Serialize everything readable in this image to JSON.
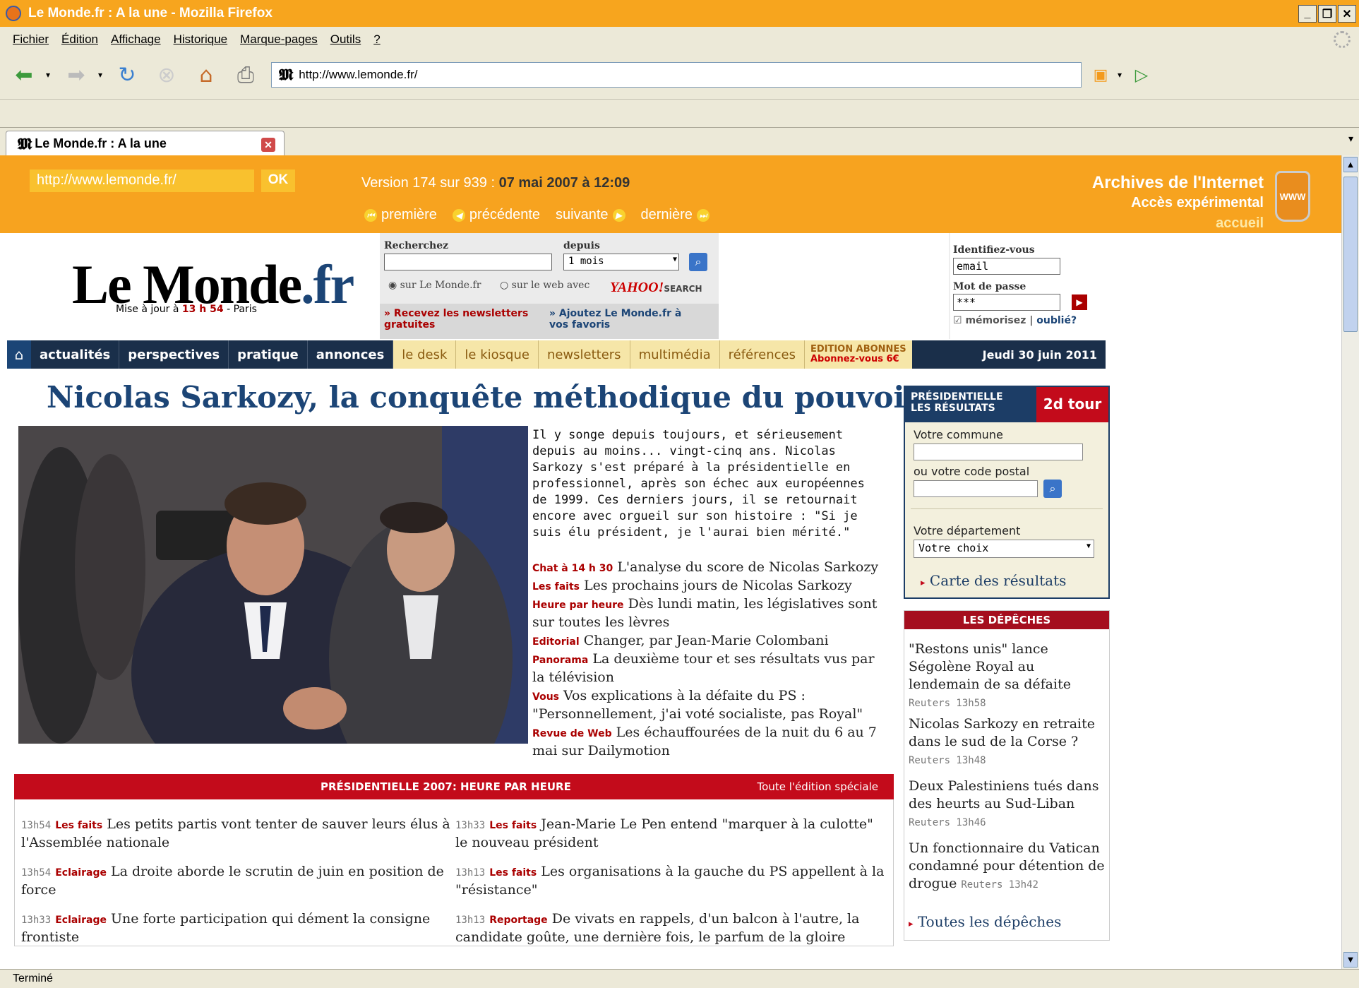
{
  "browser": {
    "window_title": "Le Monde.fr : A la une - Mozilla Firefox",
    "menu": [
      "Fichier",
      "Édition",
      "Affichage",
      "Historique",
      "Marque-pages",
      "Outils",
      "?"
    ],
    "url": "http://www.lemonde.fr/",
    "tab_title": "Le Monde.fr : A la une",
    "status": "Terminé"
  },
  "wayback": {
    "url_input": "http://www.lemonde.fr/",
    "ok": "OK",
    "version_prefix": "Version 174 sur 939 :",
    "version_date": "07 mai 2007 à 12:09",
    "nav": [
      "première",
      "précédente",
      "suivante",
      "dernière"
    ],
    "title": "Archives de l'Internet",
    "subtitle": "Accès expérimental",
    "home": "accueil",
    "can_label": "WWW"
  },
  "site": {
    "logo_main": "Le Monde",
    "logo_tld": ".fr",
    "updated_prefix": "Mise à jour à",
    "updated_time": "13 h 54",
    "updated_suffix": "- Paris",
    "search_label": "Recherchez",
    "since_label": "depuis",
    "since_value": "1 mois",
    "radio_site": "sur Le Monde.fr",
    "radio_web": "sur le web avec",
    "yahoo": "YAHOO!",
    "yahoo_search": "SEARCH",
    "newsletters_link": "» Recevez les newsletters gratuites",
    "favoris_link": "» Ajoutez Le Monde.fr à vos favoris",
    "login_label": "Identifiez-vous",
    "email_value": "email",
    "password_label": "Mot de passe",
    "password_value": "***",
    "remember": "mémorisez",
    "forgot": "oublié?"
  },
  "nav": {
    "main": [
      "actualités",
      "perspectives",
      "pratique",
      "annonces"
    ],
    "secondary": [
      "le desk",
      "le kiosque",
      "newsletters",
      "multimédia",
      "références"
    ],
    "abonnes_1": "EDITION ABONNES",
    "abonnes_2": "Abonnez-vous 6€",
    "date": "Jeudi 30 juin 2011"
  },
  "article": {
    "headline": "Nicolas Sarkozy, la conquête méthodique du pouvoir",
    "lede": "Il y songe depuis toujours, et sérieusement depuis au moins... vingt-cinq ans. Nicolas Sarkozy s'est préparé à la présidentielle en professionnel, après son échec aux européennes de 1999. Ces derniers jours, il se retournait encore avec orgueil sur son histoire : \"Si je suis élu président, je l'aurai bien mérité.\"",
    "links": [
      {
        "tag": "Chat à 14 h 30",
        "text": "L'analyse du score de Nicolas Sarkozy"
      },
      {
        "tag": "Les faits",
        "text": "Les prochains jours de Nicolas Sarkozy"
      },
      {
        "tag": "Heure par heure",
        "text": "Dès lundi matin, les législatives sont sur toutes les lèvres"
      },
      {
        "tag": "Editorial",
        "text": "Changer, par Jean-Marie Colombani"
      },
      {
        "tag": "Panorama",
        "text": "La deuxième tour et ses résultats vus par la télévision"
      },
      {
        "tag": "Vous",
        "text": "Vos explications à la défaite du PS : \"Personnellement, j'ai voté socialiste, pas Royal\""
      },
      {
        "tag": "Revue de Web",
        "text": "Les échauffourées de la nuit du 6 au 7 mai sur Dailymotion"
      }
    ]
  },
  "hourly": {
    "title": "PRÉSIDENTIELLE 2007: HEURE PAR HEURE",
    "link": "Toute l'édition spéciale",
    "left": [
      {
        "time": "13h54",
        "tag": "Les faits",
        "text": "Les petits partis vont tenter de sauver leurs élus à l'Assemblée nationale"
      },
      {
        "time": "13h54",
        "tag": "Eclairage",
        "text": "La droite aborde le scrutin de juin en position de force"
      },
      {
        "time": "13h33",
        "tag": "Eclairage",
        "text": "Une forte participation qui dément la consigne frontiste"
      }
    ],
    "right": [
      {
        "time": "13h33",
        "tag": "Les faits",
        "text": "Jean-Marie Le Pen entend \"marquer à la culotte\" le nouveau président"
      },
      {
        "time": "13h13",
        "tag": "Les faits",
        "text": "Les organisations à la gauche du PS appellent à la \"résistance\""
      },
      {
        "time": "13h13",
        "tag": "Reportage",
        "text": "De vivats en rappels, d'un balcon à l'autre, la candidate goûte, une dernière fois, le parfum de la gloire"
      }
    ]
  },
  "results": {
    "title_1": "PRÉSIDENTIELLE",
    "title_2": "LES RÉSULTATS",
    "round": "2d tour",
    "commune_label": "Votre commune",
    "postal_label": "ou votre code postal",
    "dept_label": "Votre département",
    "dept_value": "Votre choix",
    "map_link": "Carte des résultats"
  },
  "depeches": {
    "title": "LES DÉPÊCHES",
    "items": [
      {
        "text": "\"Restons unis\" lance Ségolène Royal au lendemain de sa défaite",
        "src": "Reuters 13h58"
      },
      {
        "text": "Nicolas Sarkozy en retraite dans le sud de la Corse ?",
        "src": "Reuters 13h48"
      },
      {
        "text": "Deux Palestiniens tués dans des heurts au Sud-Liban",
        "src": "Reuters 13h46"
      },
      {
        "text": "Un fonctionnaire du Vatican condamné pour détention de drogue",
        "src": "Reuters 13h42"
      }
    ],
    "all": "Toutes les dépêches"
  }
}
